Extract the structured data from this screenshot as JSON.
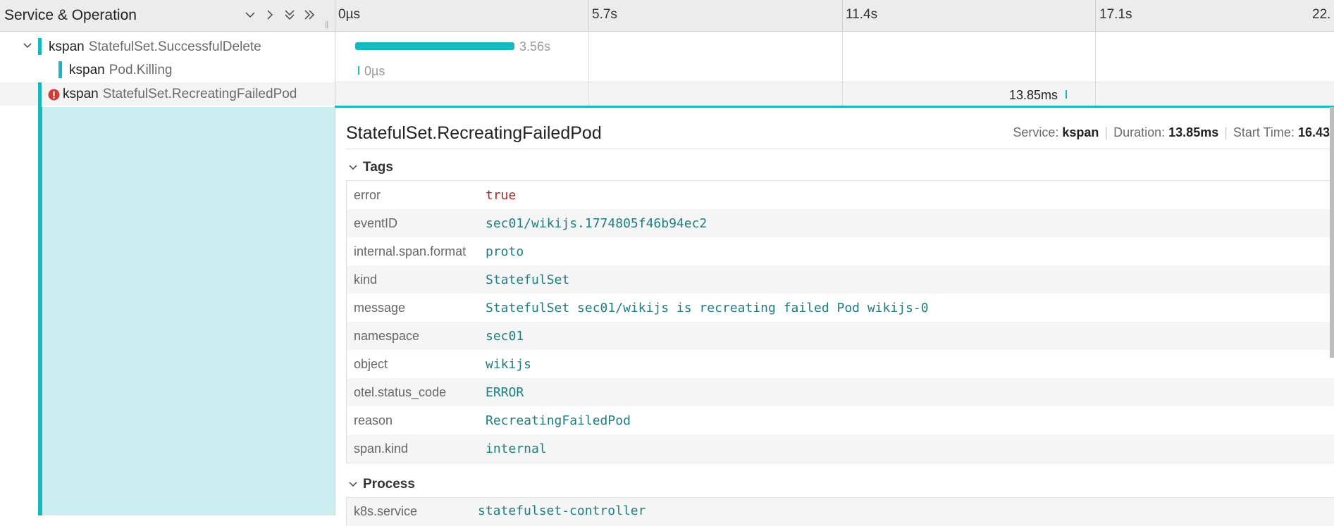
{
  "header": {
    "title": "Service & Operation",
    "ticks": [
      "0µs",
      "5.7s",
      "11.4s",
      "17.1s",
      "22."
    ]
  },
  "spans": [
    {
      "service": "kspan",
      "operation": "StatefulSet.SuccessfulDelete",
      "duration_label": "3.56s",
      "collapsed": false
    },
    {
      "service": "kspan",
      "operation": "Pod.Killing",
      "duration_label": "0µs"
    },
    {
      "service": "kspan",
      "operation": "StatefulSet.RecreatingFailedPod",
      "duration_label": "13.85ms",
      "error": true
    }
  ],
  "detail": {
    "title": "StatefulSet.RecreatingFailedPod",
    "service_label": "Service:",
    "service": "kspan",
    "duration_label": "Duration:",
    "duration": "13.85ms",
    "start_label": "Start Time:",
    "start": "16.43",
    "tags_title": "Tags",
    "tags": [
      {
        "key": "error",
        "value": "true"
      },
      {
        "key": "eventID",
        "value": "sec01/wikijs.1774805f46b94ec2"
      },
      {
        "key": "internal.span.format",
        "value": "proto"
      },
      {
        "key": "kind",
        "value": "StatefulSet"
      },
      {
        "key": "message",
        "value": "StatefulSet sec01/wikijs is recreating failed Pod wikijs-0"
      },
      {
        "key": "namespace",
        "value": "sec01"
      },
      {
        "key": "object",
        "value": "wikijs"
      },
      {
        "key": "otel.status_code",
        "value": "ERROR"
      },
      {
        "key": "reason",
        "value": "RecreatingFailedPod"
      },
      {
        "key": "span.kind",
        "value": "internal"
      }
    ],
    "process_title": "Process",
    "process": [
      {
        "key": "k8s.service",
        "value": "statefulset-controller"
      }
    ]
  },
  "colors": {
    "accent": "#17b8be",
    "error": "#d23939",
    "selected_bg": "#cdeef1"
  }
}
